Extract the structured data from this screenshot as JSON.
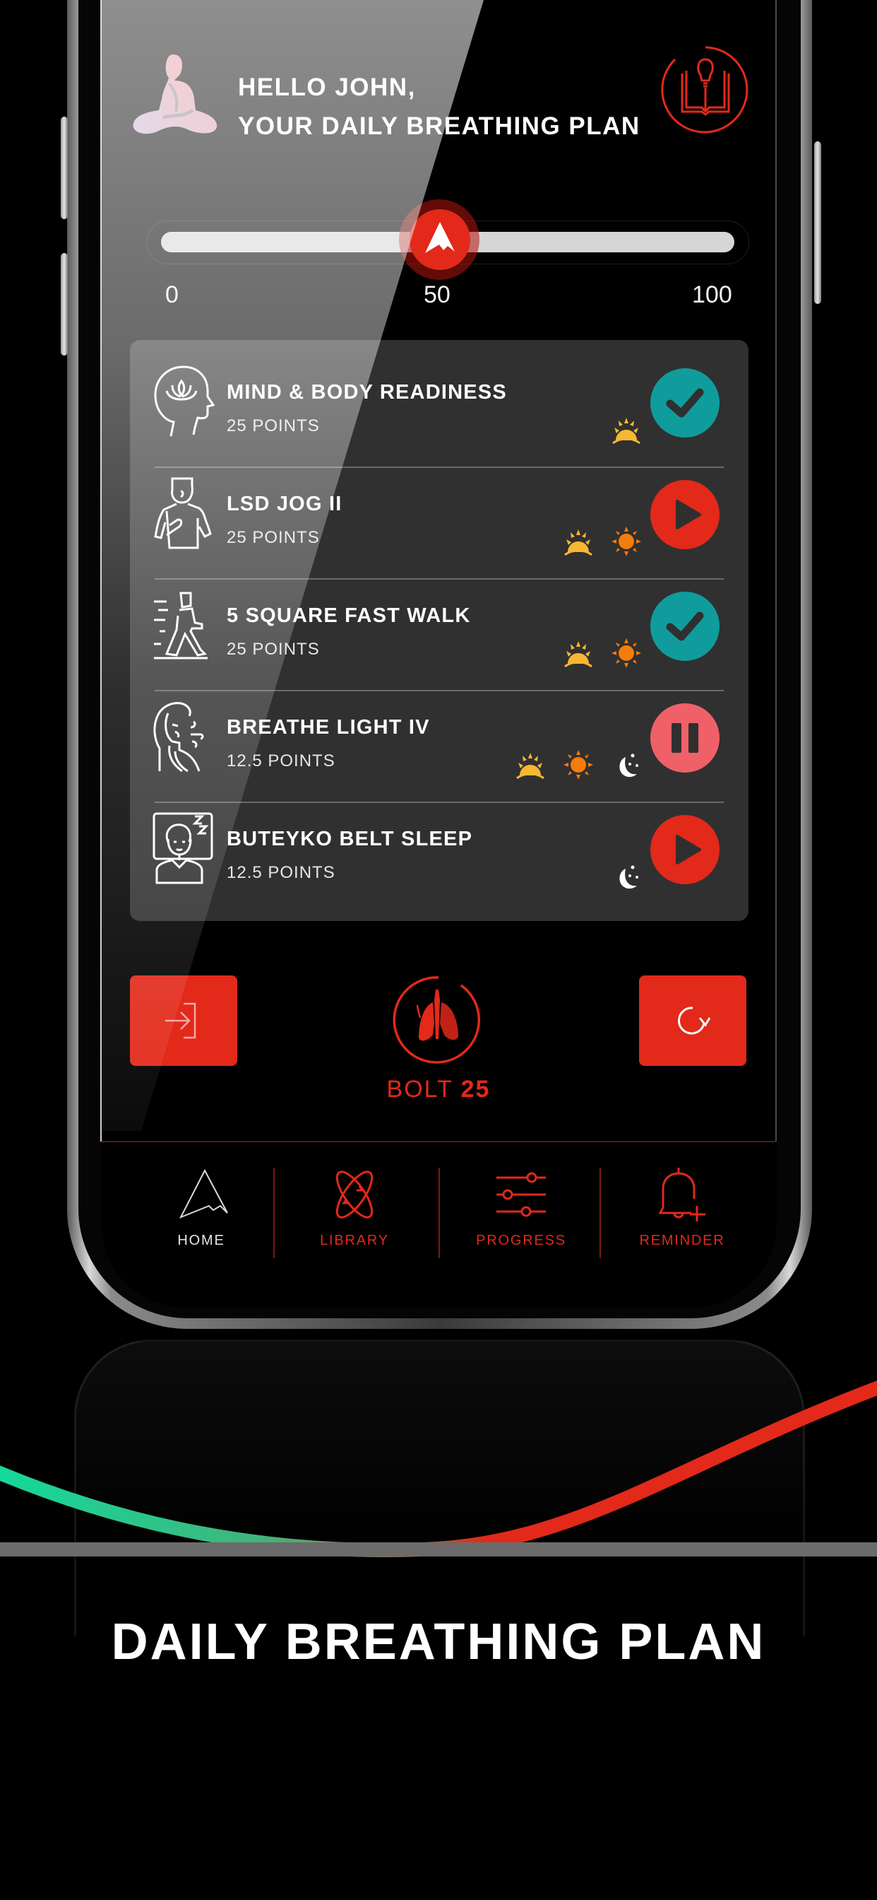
{
  "header": {
    "greeting_line1": "HELLO JOHN,",
    "greeting_line2": "YOUR DAILY BREATHING PLAN",
    "logo_icon": "meditation-figure-icon",
    "library_button_icon": "book-lightbulb-icon"
  },
  "slider": {
    "min_label": "0",
    "mid_label": "50",
    "max_label": "100",
    "value": 50,
    "thumb_icon": "mountain-peak-icon"
  },
  "exercises": [
    {
      "title": "MIND & BODY READINESS",
      "points": "25 POINTS",
      "icon": "head-lotus-icon",
      "times": [
        "sunrise"
      ],
      "status": "completed"
    },
    {
      "title": "LSD JOG II",
      "points": "25 POINTS",
      "icon": "jogger-icon",
      "times": [
        "sunrise",
        "sun"
      ],
      "status": "play"
    },
    {
      "title": "5 SQUARE FAST WALK",
      "points": "25 POINTS",
      "icon": "fast-walker-icon",
      "times": [
        "sunrise",
        "sun"
      ],
      "status": "completed"
    },
    {
      "title": "BREATHE LIGHT IV",
      "points": "12.5 POINTS",
      "icon": "person-exhale-icon",
      "times": [
        "sunrise",
        "sun",
        "moon"
      ],
      "status": "paused"
    },
    {
      "title": "BUTEYKO BELT SLEEP",
      "points": "12.5 POINTS",
      "icon": "sleeping-person-icon",
      "times": [
        "moon"
      ],
      "status": "play"
    }
  ],
  "controls": {
    "login_icon": "sign-in-icon",
    "refresh_icon": "refresh-icon",
    "bolt_prefix": "BOLT",
    "bolt_value": "25",
    "bolt_icon": "lungs-icon"
  },
  "tabs": [
    {
      "label": "HOME",
      "icon": "mountain-icon",
      "active": true
    },
    {
      "label": "LIBRARY",
      "icon": "orbit-icon",
      "active": false
    },
    {
      "label": "PROGRESS",
      "icon": "sliders-icon",
      "active": false
    },
    {
      "label": "REMINDER",
      "icon": "bell-plus-icon",
      "active": false
    }
  ],
  "caption": "DAILY BREATHING PLAN",
  "colors": {
    "accent_red": "#e2291a",
    "teal_completed": "#109c9c",
    "paused_pink": "#f06068",
    "card_bg": "#303030",
    "sunrise_yellow": "#f7b733",
    "sun_orange": "#f57c0b",
    "wave_start": "#14d99b",
    "wave_end": "#e2291a"
  }
}
